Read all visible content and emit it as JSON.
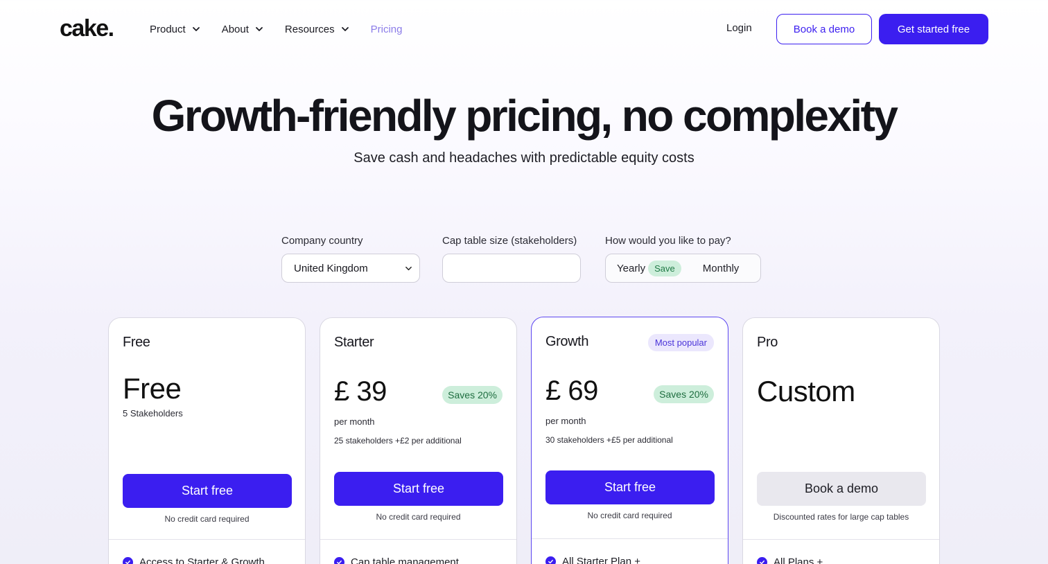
{
  "nav": {
    "logo": "cake.",
    "menu": [
      {
        "label": "Product"
      },
      {
        "label": "About"
      },
      {
        "label": "Resources"
      },
      {
        "label": "Pricing"
      }
    ],
    "login": "Login",
    "book_demo": "Book a demo",
    "get_started": "Get started free"
  },
  "hero": {
    "title": "Growth-friendly pricing, no complexity",
    "subtitle": "Save cash and headaches with predictable equity costs"
  },
  "filters": {
    "country_label": "Company country",
    "country_value": "United Kingdom",
    "cap_label": "Cap table size (stakeholders)",
    "cap_value": "",
    "pay_label": "How would you like to pay?",
    "pay_yearly": "Yearly",
    "pay_save": "Save",
    "pay_monthly": "Monthly"
  },
  "cards": [
    {
      "name": "Free",
      "price": "Free",
      "detail": "5 Stakeholders",
      "button": "Start free",
      "note": "No credit card required",
      "feature": "Access to Starter & Growth"
    },
    {
      "name": "Starter",
      "price": "£ 39",
      "save_badge": "Saves 20%",
      "period": "per month",
      "detail": "25 stakeholders +£2  per additional",
      "button": "Start free",
      "note": "No credit card required",
      "feature": "Cap table management"
    },
    {
      "name": "Growth",
      "popular_badge": "Most popular",
      "price": "£ 69",
      "save_badge": "Saves 20%",
      "period": "per month",
      "detail": "30 stakeholders +£5 per additional",
      "button": "Start free",
      "note": "No credit card required",
      "feature": "All Starter Plan +"
    },
    {
      "name": "Pro",
      "price": "Custom",
      "button": "Book a demo",
      "note": "Discounted rates for large cap tables",
      "feature": "All Plans +"
    }
  ],
  "colors": {
    "accent": "#3b1ef0",
    "save_green_bg": "#cdeedb",
    "pricing_active": "#8b7ce8"
  }
}
